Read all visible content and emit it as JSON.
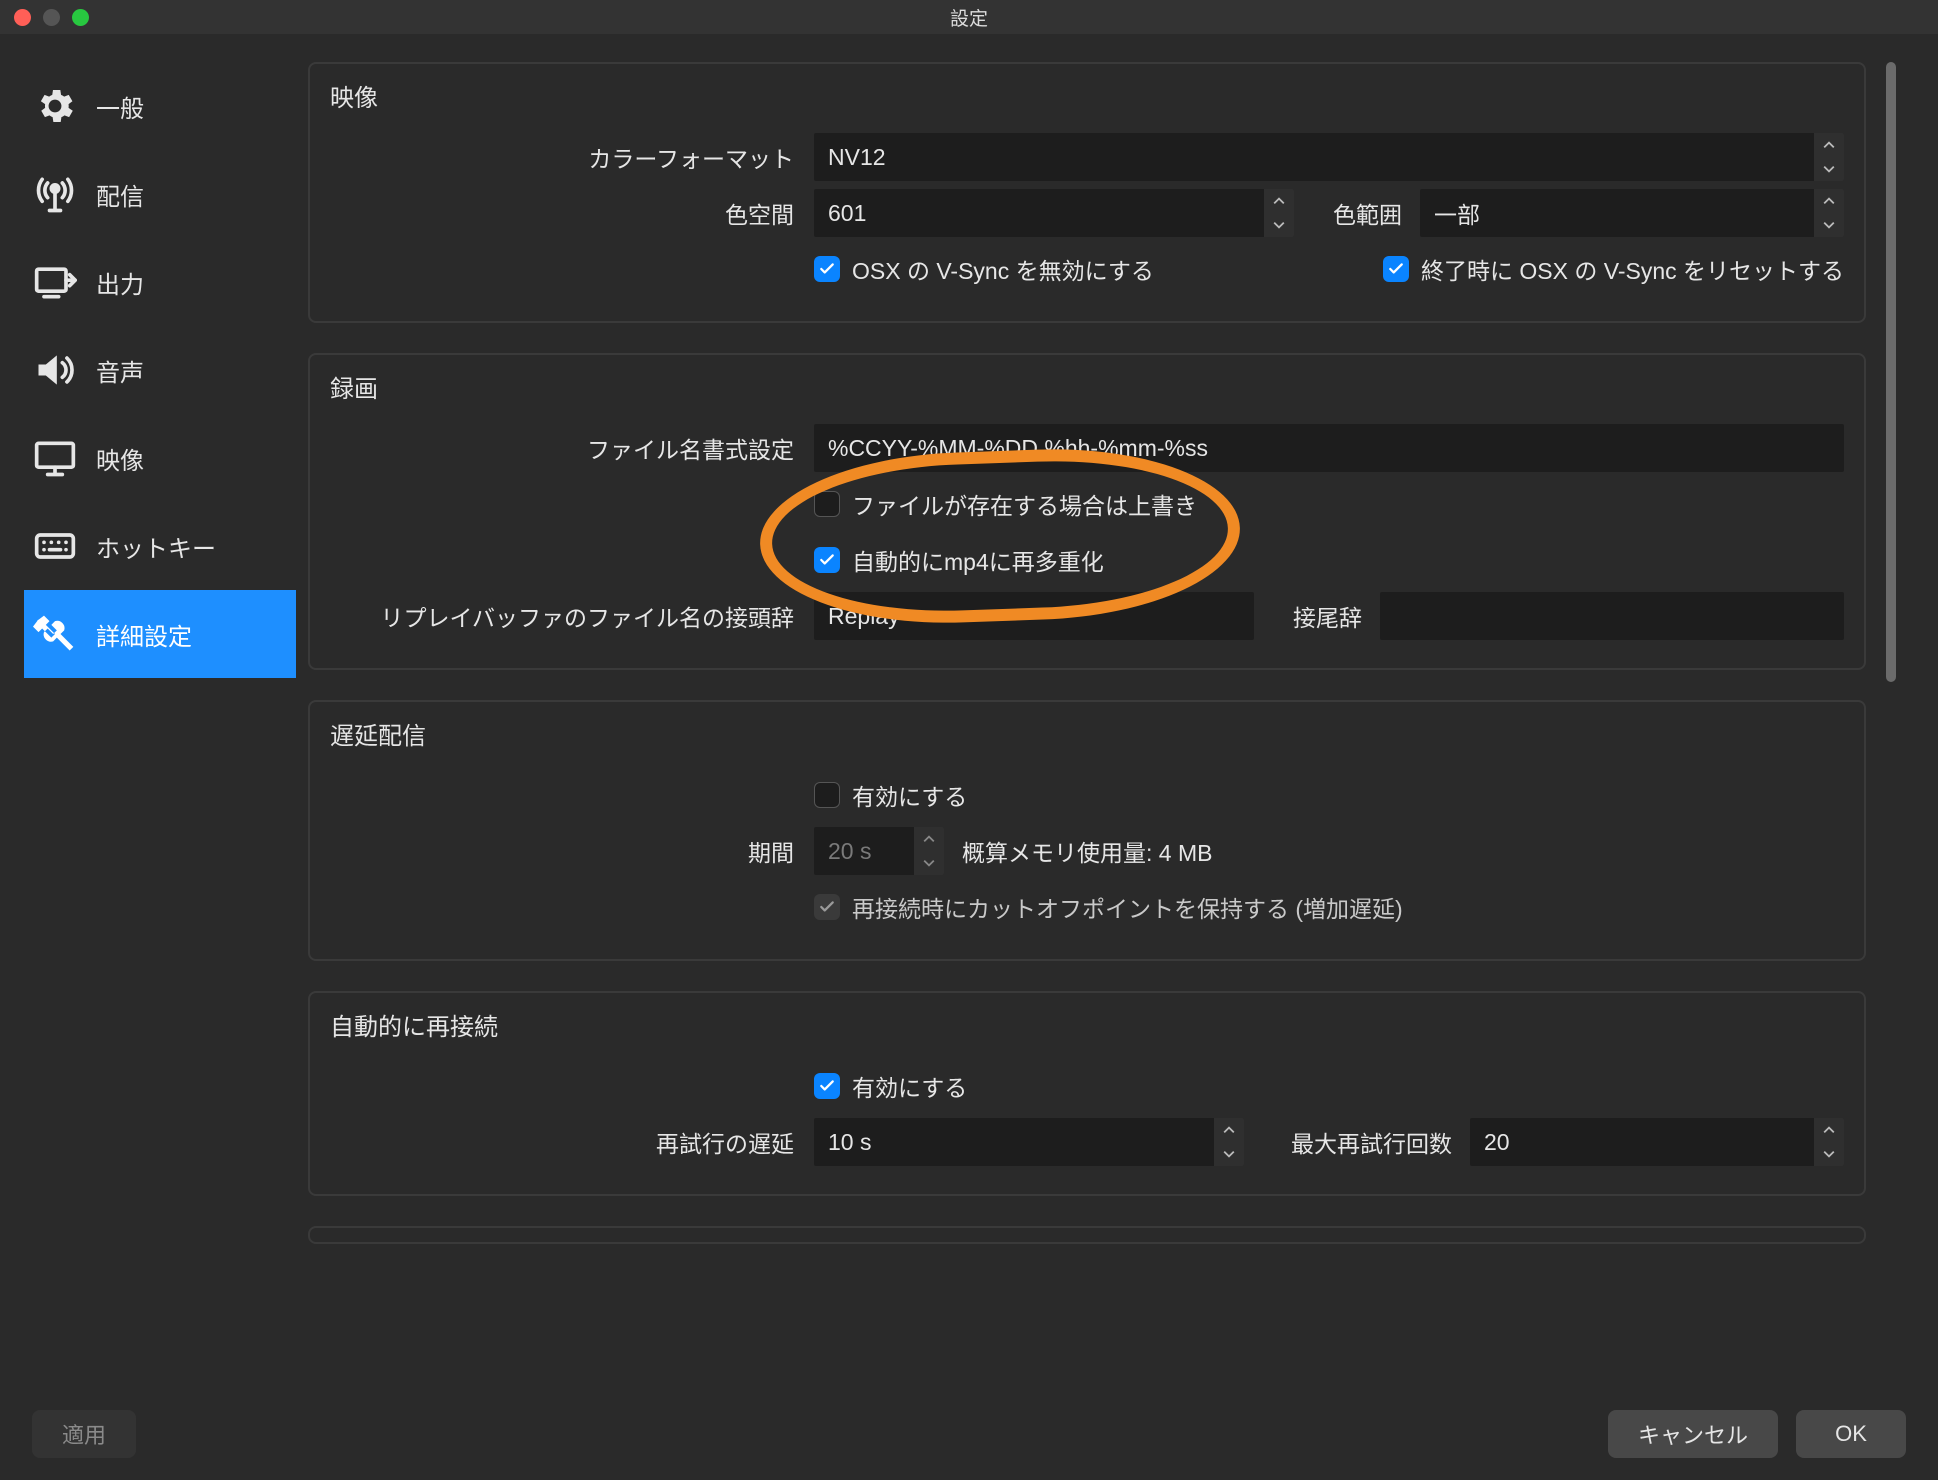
{
  "window": {
    "title": "設定"
  },
  "sidebar": {
    "items": [
      {
        "id": "general",
        "label": "一般"
      },
      {
        "id": "stream",
        "label": "配信"
      },
      {
        "id": "output",
        "label": "出力"
      },
      {
        "id": "audio",
        "label": "音声"
      },
      {
        "id": "video",
        "label": "映像"
      },
      {
        "id": "hotkeys",
        "label": "ホットキー"
      },
      {
        "id": "advanced",
        "label": "詳細設定"
      }
    ],
    "active": "advanced"
  },
  "groups": {
    "video": {
      "title": "映像",
      "color_format_label": "カラーフォーマット",
      "color_format_value": "NV12",
      "color_space_label": "色空間",
      "color_space_value": "601",
      "color_range_label": "色範囲",
      "color_range_value": "一部",
      "disable_vsync_label": "OSX の V-Sync を無効にする",
      "disable_vsync_checked": true,
      "reset_vsync_label": "終了時に OSX の V-Sync をリセットする",
      "reset_vsync_checked": true
    },
    "recording": {
      "title": "録画",
      "filename_fmt_label": "ファイル名書式設定",
      "filename_fmt_value": "%CCYY-%MM-%DD %hh-%mm-%ss",
      "overwrite_label": "ファイルが存在する場合は上書き",
      "overwrite_checked": false,
      "remux_label": "自動的にmp4に再多重化",
      "remux_checked": true,
      "replay_prefix_label": "リプレイバッファのファイル名の接頭辞",
      "replay_prefix_value": "Replay",
      "replay_suffix_label": "接尾辞",
      "replay_suffix_value": ""
    },
    "delay": {
      "title": "遅延配信",
      "enable_label": "有効にする",
      "enable_checked": false,
      "duration_label": "期間",
      "duration_value": "20 s",
      "memory_label": "概算メモリ使用量: 4 MB",
      "preserve_label": "再接続時にカットオフポイントを保持する (増加遅延)",
      "preserve_checked": true
    },
    "reconnect": {
      "title": "自動的に再接続",
      "enable_label": "有効にする",
      "enable_checked": true,
      "retry_delay_label": "再試行の遅延",
      "retry_delay_value": "10 s",
      "max_retries_label": "最大再試行回数",
      "max_retries_value": "20"
    }
  },
  "buttons": {
    "apply": "適用",
    "cancel": "キャンセル",
    "ok": "OK"
  }
}
